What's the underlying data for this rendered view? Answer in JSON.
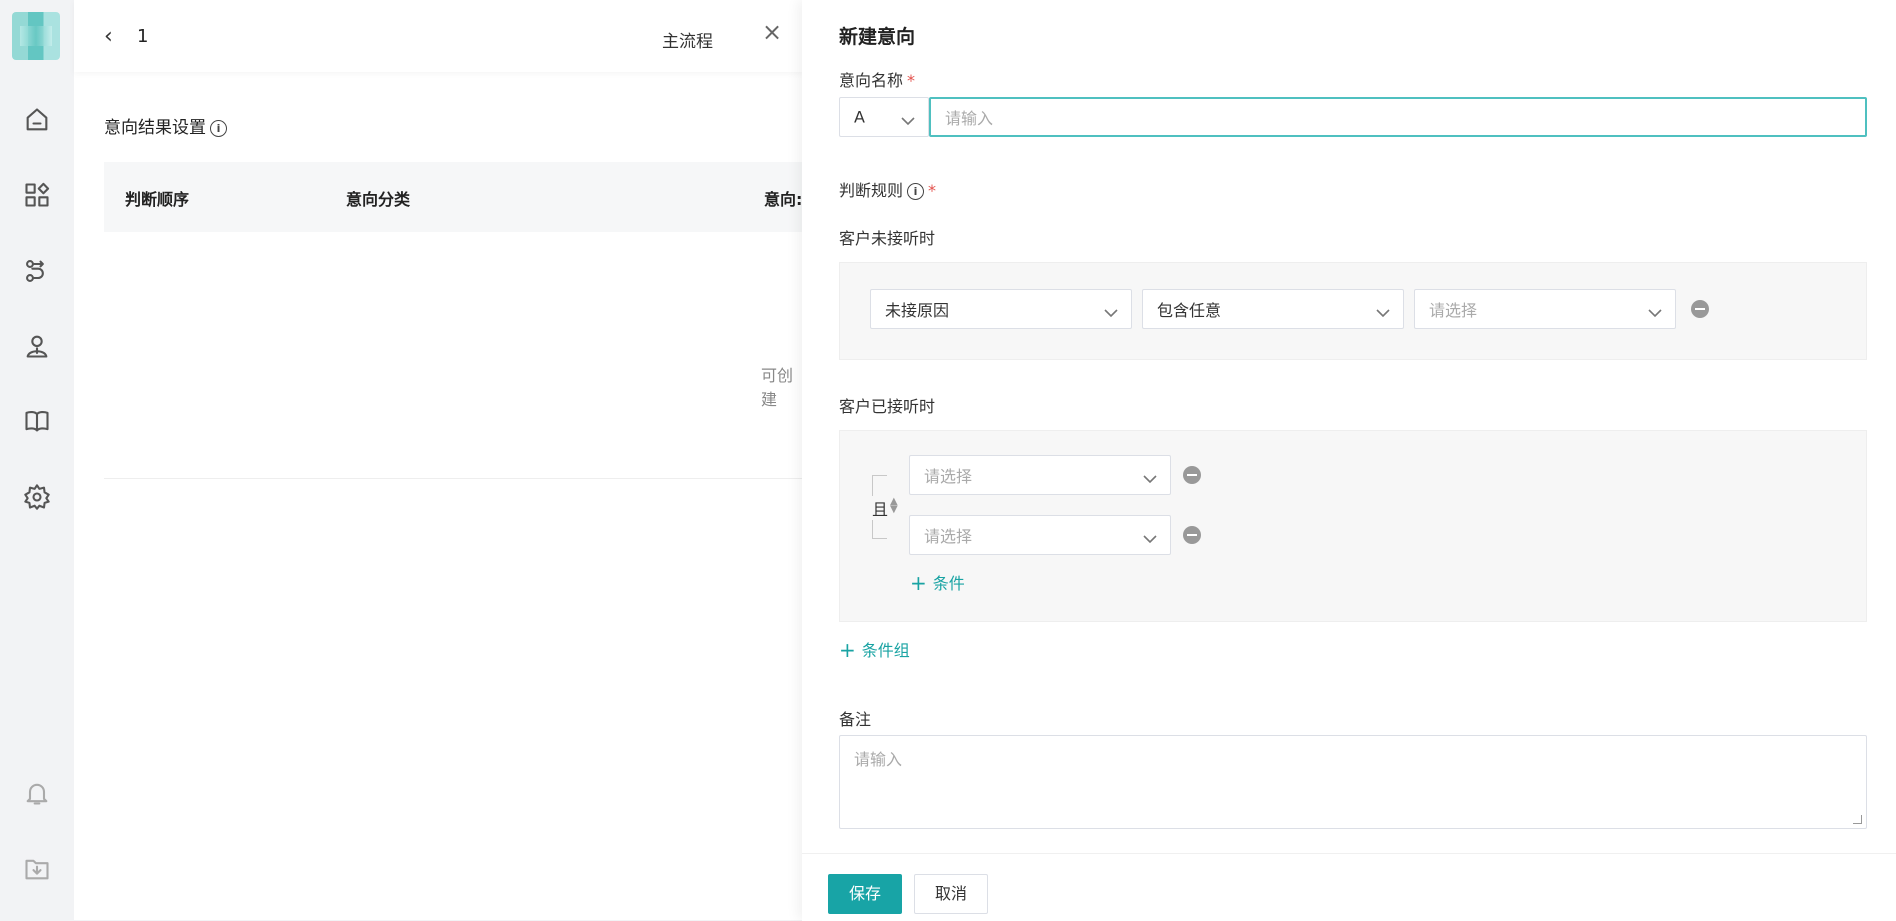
{
  "nav": {
    "icons": [
      "home-icon",
      "apps-icon",
      "flow-icon",
      "user-icon",
      "book-icon",
      "gear-icon",
      "bell-icon",
      "download-folder-icon"
    ]
  },
  "page": {
    "back_number": "1",
    "tab_main": "主流程",
    "close": "×",
    "section_title": "意向结果设置",
    "columns": [
      "判断顺序",
      "意向分类",
      "意向:"
    ],
    "empty_text": "可创建"
  },
  "drawer": {
    "title": "新建意向",
    "name_label": "意向名称",
    "required_mark": "*",
    "name_prefix_value": "A",
    "name_placeholder": "请输入",
    "rules_label": "判断规则",
    "unanswered_label": "客户未接听时",
    "unanswered_row": {
      "field": "未接原因",
      "operator": "包含任意",
      "value_placeholder": "请选择"
    },
    "answered_label": "客户已接听时",
    "and_label": "且",
    "answered_rows": [
      {
        "placeholder": "请选择"
      },
      {
        "placeholder": "请选择"
      }
    ],
    "add_condition": "条件",
    "add_condition_group": "条件组",
    "remark_label": "备注",
    "remark_placeholder": "请输入",
    "save": "保存",
    "cancel": "取消"
  },
  "colors": {
    "accent": "#18a4a6",
    "required": "#e3514c"
  }
}
